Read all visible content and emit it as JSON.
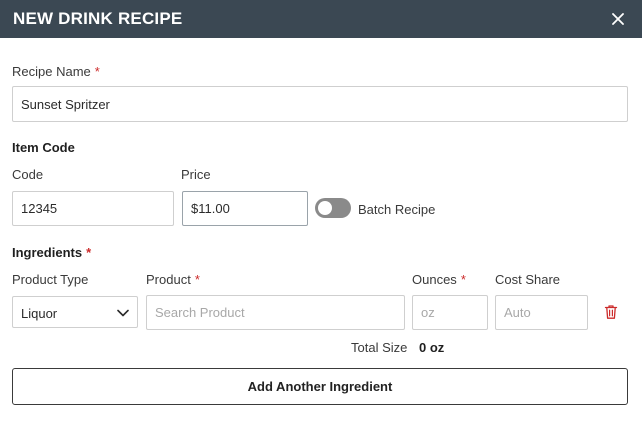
{
  "header": {
    "title": "New Drink Recipe",
    "close_icon": "close-icon",
    "background_color": "#3b4853"
  },
  "recipe_name": {
    "label": "Recipe Name",
    "required_mark": "*",
    "value": "Sunset Spritzer"
  },
  "item_code": {
    "section_title": "Item Code",
    "code_label": "Code",
    "code_value": "12345",
    "price_label": "Price",
    "price_value": "$11.00",
    "batch_toggle_label": "Batch Recipe",
    "batch_toggle_on": false
  },
  "ingredients": {
    "section_title": "Ingredients",
    "required_mark": "*",
    "columns": {
      "product_type": "Product Type",
      "product": "Product",
      "ounces": "Ounces",
      "cost_share": "Cost Share"
    },
    "rows": [
      {
        "product_type": "Liquor",
        "product_placeholder": "Search Product",
        "ounces_placeholder": "oz",
        "cost_share_placeholder": "Auto",
        "delete_icon": "trash-icon"
      }
    ],
    "total_size_label": "Total Size",
    "total_size_value": "0 oz",
    "add_button_label": "Add Another Ingredient"
  },
  "colors": {
    "required": "#cc2b2b",
    "delete_icon": "#cc2b2b",
    "toggle_off": "#8a8a8a"
  }
}
